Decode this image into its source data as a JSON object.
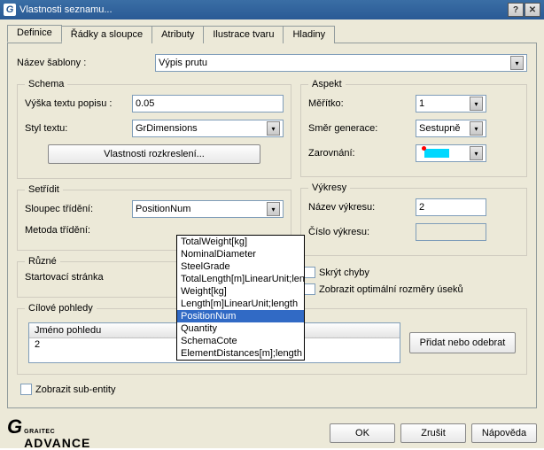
{
  "title": "Vlastnosti seznamu...",
  "tabs": [
    "Definice",
    "Řádky a sloupce",
    "Atributy",
    "Ilustrace tvaru",
    "Hladiny"
  ],
  "template_name_label": "Název šablony :",
  "template_name_value": "Výpis prutu",
  "groups": {
    "schema": "Schema",
    "aspekt": "Aspekt",
    "sort": "Setřídit",
    "vykresy": "Výkresy",
    "ruzne": "Různé",
    "cilove": "Cílové pohledy"
  },
  "schema": {
    "height_label": "Výška textu popisu :",
    "height_value": "0.05",
    "style_label": "Styl textu:",
    "style_value": "GrDimensions",
    "props_button": "Vlastnosti rozkreslení..."
  },
  "aspekt": {
    "scale_label": "Měřítko:",
    "scale_value": "1",
    "dir_label": "Směr generace:",
    "dir_value": "Sestupně",
    "align_label": "Zarovnání:"
  },
  "sort": {
    "col_label": "Sloupec třídění:",
    "col_value": "PositionNum",
    "method_label": "Metoda třídění:",
    "options": [
      "TotalWeight[kg]",
      "NominalDiameter",
      "SteelGrade",
      "TotalLength[m]LinearUnit;length",
      "Weight[kg]",
      "Length[m]LinearUnit;length",
      "PositionNum",
      "Quantity",
      "SchemaCote",
      "ElementDistances[m];length"
    ]
  },
  "vykresy": {
    "name_label": "Název výkresu:",
    "name_value": "2",
    "num_label": "Číslo výkresu:"
  },
  "ruzne": {
    "start_label": "Startovací stránka",
    "chk1": "Skrýt chyby",
    "chk2": "Zobrazit optimální rozměry úseků"
  },
  "cilove": {
    "header": "Jméno pohledu",
    "item": "2",
    "add_button": "Přidat nebo odebrat"
  },
  "sub_entity_chk": "Zobrazit sub-entity",
  "logo": {
    "brand": "GRAITEC",
    "product": "ADVANCE"
  },
  "buttons": {
    "ok": "OK",
    "cancel": "Zrušit",
    "help": "Nápověda"
  }
}
